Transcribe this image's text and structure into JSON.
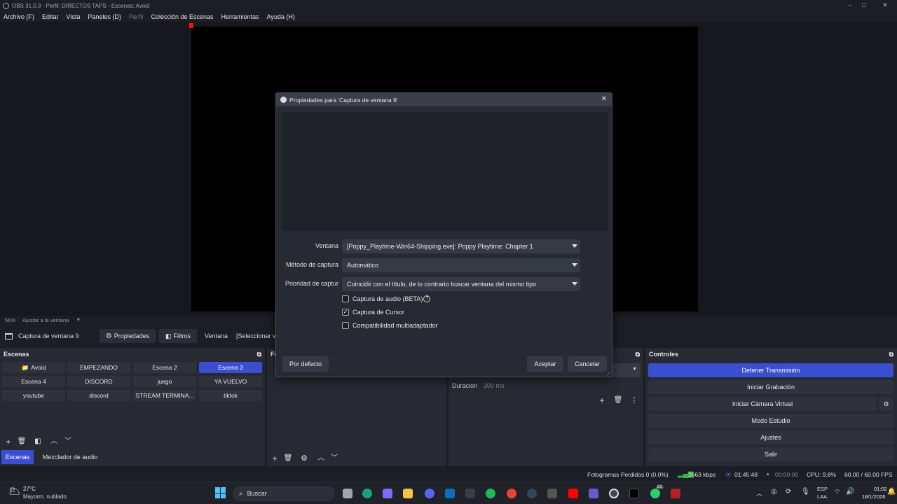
{
  "window": {
    "title": "OBS 31.0.3 - Perfil: DIRECTOS TAPS - Escenas: Avoid",
    "minimize": "–",
    "maximize": "□",
    "close": "✕"
  },
  "menu": [
    {
      "label": "Archivo (F)"
    },
    {
      "label": "Editar"
    },
    {
      "label": "Vista"
    },
    {
      "label": "Paneles (D)"
    },
    {
      "label": "Perfil"
    },
    {
      "label": "Colección de Escenas"
    },
    {
      "label": "Herramientas"
    },
    {
      "label": "Ayuda (H)"
    }
  ],
  "zoom": {
    "percent": "56%",
    "mode": "Ajustar a la ventana"
  },
  "source_bar": {
    "source_name": "Captura de ventana 9",
    "properties": "Propiedades",
    "filters": "Filtros",
    "window_label": "Ventana",
    "window_value": "[Seleccionar ve"
  },
  "scenes_dock": {
    "title": "Escenas",
    "items": [
      "Avoid",
      "EMPEZANDO",
      "Escena 2",
      "Escena 3",
      "Escena 4",
      "DISCORD",
      "juego",
      "YA VUELVO",
      "youtube",
      "discord",
      "STREAM TERMINA...",
      "tiktok"
    ],
    "selected": "Escena 3"
  },
  "bottom_tabs": {
    "scenes": "Escenas",
    "mixer": "Mezclador de audio"
  },
  "sources_dock": {
    "title": "Fu"
  },
  "transitions_dock": {
    "duration_label": "Duración",
    "duration_value": "300 ms"
  },
  "controls": {
    "title": "Controles",
    "stop_stream": "Detener Transmisión",
    "start_recording": "Iniciar Grabación",
    "start_virtual_cam": "Iniciar Cámara Virtual",
    "studio_mode": "Modo Estudio",
    "settings": "Ajustes",
    "exit": "Salir"
  },
  "status": {
    "dropped_frames": "Fotogramas Perdidos 0 (0.0%)",
    "bitrate": "2663 kbps",
    "stream_time": "01:45:48",
    "rec_time": "00:00:00",
    "cpu": "CPU: 9.8%",
    "fps": "60.00 / 60.00 FPS"
  },
  "dialog": {
    "title": "Propiedades para 'Captura de ventana 9'",
    "window_label": "Ventana",
    "window_value": "[Poppy_Playtime-Win64-Shipping.exe]: Poppy Playtime: Chapter 1",
    "method_label": "Método de captura",
    "method_value": "Automático",
    "priority_label": "Prioridad de captur",
    "priority_value": "Coincidir con el título, de lo contrario buscar ventana del mismo tipo",
    "audio_capture": "Captura de audio (BETA)",
    "audio_capture_checked": false,
    "cursor_capture": "Captura de Cursor",
    "cursor_capture_checked": true,
    "multiadapter": "Compatibilidad multiadaptador",
    "multiadapter_checked": false,
    "defaults": "Por defecto",
    "ok": "Aceptar",
    "cancel": "Cancelar"
  },
  "taskbar": {
    "temperature": "27°C",
    "weather": "Mayorm. nublado",
    "search": "Buscar",
    "lang1": "ESP",
    "lang2": "LAA",
    "time": "01:02",
    "date": "18/1/2026",
    "badge": "21"
  }
}
